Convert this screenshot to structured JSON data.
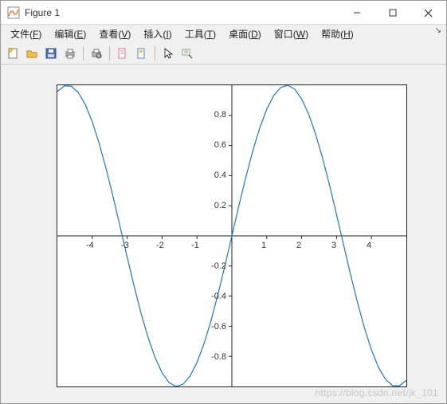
{
  "window": {
    "title": "Figure 1"
  },
  "menubar": {
    "items": [
      {
        "label": "文件",
        "hotkey": "F"
      },
      {
        "label": "编辑",
        "hotkey": "E"
      },
      {
        "label": "查看",
        "hotkey": "V"
      },
      {
        "label": "插入",
        "hotkey": "I"
      },
      {
        "label": "工具",
        "hotkey": "T"
      },
      {
        "label": "桌面",
        "hotkey": "D"
      },
      {
        "label": "窗口",
        "hotkey": "W"
      },
      {
        "label": "帮助",
        "hotkey": "H"
      }
    ]
  },
  "toolbar": {
    "icons": [
      "new-figure",
      "open",
      "save",
      "print",
      "|",
      "print-preview",
      "|",
      "link",
      "brush",
      "|",
      "pointer",
      "data-cursor"
    ]
  },
  "chart_data": {
    "type": "line",
    "title": "",
    "xlabel": "",
    "ylabel": "",
    "xlim": [
      -5,
      5
    ],
    "ylim": [
      -1,
      1
    ],
    "xticks": [
      -4,
      -3,
      -2,
      -1,
      1,
      2,
      3,
      4
    ],
    "yticks": [
      -0.8,
      -0.6,
      -0.4,
      -0.2,
      0.2,
      0.4,
      0.6,
      0.8
    ],
    "function": "sin(x)",
    "color": "#1f77b4",
    "x": [
      -5,
      -4.8,
      -4.6,
      -4.4,
      -4.2,
      -4,
      -3.8,
      -3.6,
      -3.4,
      -3.2,
      -3,
      -2.8,
      -2.6,
      -2.4,
      -2.2,
      -2,
      -1.8,
      -1.6,
      -1.4,
      -1.2,
      -1,
      -0.8,
      -0.6,
      -0.4,
      -0.2,
      0,
      0.2,
      0.4,
      0.6,
      0.8,
      1,
      1.2,
      1.4,
      1.6,
      1.8,
      2,
      2.2,
      2.4,
      2.6,
      2.8,
      3,
      3.2,
      3.4,
      3.6,
      3.8,
      4,
      4.2,
      4.4,
      4.6,
      4.8,
      5
    ],
    "y": [
      0.959,
      0.996,
      0.994,
      0.952,
      0.872,
      0.757,
      0.612,
      0.443,
      0.256,
      0.058,
      -0.141,
      -0.335,
      -0.516,
      -0.675,
      -0.808,
      -0.909,
      -0.974,
      -1.0,
      -0.985,
      -0.932,
      -0.841,
      -0.717,
      -0.565,
      -0.389,
      -0.199,
      0.0,
      0.199,
      0.389,
      0.565,
      0.717,
      0.841,
      0.932,
      0.985,
      1.0,
      0.974,
      0.909,
      0.808,
      0.675,
      0.516,
      0.335,
      0.141,
      -0.058,
      -0.256,
      -0.443,
      -0.612,
      -0.757,
      -0.872,
      -0.952,
      -0.994,
      -0.996,
      -0.959
    ]
  },
  "watermark": "https://blog.csdn.net/jk_101"
}
